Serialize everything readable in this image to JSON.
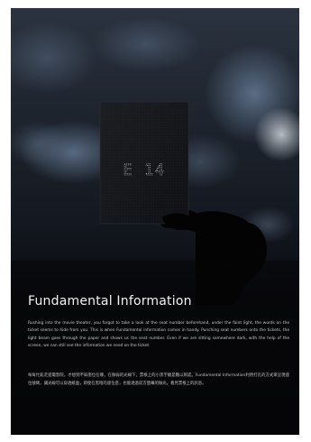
{
  "ticket": {
    "seat_number": "E 14"
  },
  "article": {
    "heading": "Fundamental Information",
    "body_en": "Rushing into the movie theater, you forgot to take a look at the seat number beforehand, under the faint light, the words on the ticket seems to hide from you. This is when Fundamental information comes in handy. Punching seat numbers onto the tickets, the light beam goes through the paper and shows us the seat number. Even if we are sitting somewhere dark, with the help of the screen, we can still see the information we need on the ticket.",
    "body_zh": "每每忙亂走進電影院，才想到不知座位在哪，在微弱的光線下，票根上的小黑字總是難以辨認。Fundamental Information利用打孔的方式來呈現座位號碼，讓光線可以穿透紙面，即使在黑暗的座位區，也能透過前方螢幕的微光，看見票根上的訊息。"
  },
  "colors": {
    "page_background": "#0b0b0f",
    "heading_text": "#f2f2f2",
    "body_text": "#c8c8c8"
  }
}
